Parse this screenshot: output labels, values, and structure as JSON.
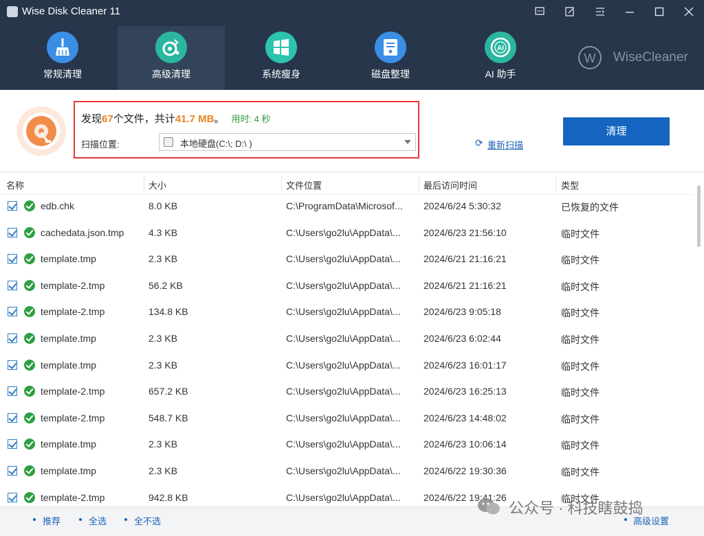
{
  "window": {
    "title": "Wise Disk Cleaner 11",
    "controls": [
      "feedback-icon",
      "notes-icon",
      "menu-icon",
      "minimize-icon",
      "maximize-icon",
      "close-icon"
    ]
  },
  "nav": {
    "items": [
      {
        "label": "常规清理",
        "icon": "broom-icon",
        "color": "#3a8ee6",
        "active": false
      },
      {
        "label": "高级清理",
        "icon": "advanced-clean-icon",
        "color": "#2bb6a0",
        "active": true
      },
      {
        "label": "系统瘦身",
        "icon": "windows-icon",
        "color": "#2cc3b0",
        "active": false
      },
      {
        "label": "磁盘整理",
        "icon": "defrag-icon",
        "color": "#3a8ee6",
        "active": false
      },
      {
        "label": "AI 助手",
        "icon": "ai-icon",
        "color": "#2bb6a0",
        "active": false
      }
    ],
    "brand": "WiseCleaner"
  },
  "summary": {
    "found_prefix": "发现",
    "file_count": "67",
    "files_word": "个文件，共计",
    "total_size": "41.7 MB",
    "period": "。",
    "time_used": "用时: 4 秒",
    "scan_location_label": "扫描位置:",
    "scan_location_value": "本地硬盘(C:\\; D:\\ )",
    "rescan_label": "重新扫描",
    "clean_button": "清理"
  },
  "table": {
    "headers": [
      "名称",
      "大小",
      "文件位置",
      "最后访问时间",
      "类型"
    ],
    "rows": [
      {
        "name": "edb.chk",
        "size": "8.0 KB",
        "path": "C:\\ProgramData\\Microsof...",
        "time": "2024/6/24 5:30:32",
        "type": "已恢复的文件"
      },
      {
        "name": "cachedata.json.tmp",
        "size": "4.3 KB",
        "path": "C:\\Users\\go2lu\\AppData\\...",
        "time": "2024/6/23 21:56:10",
        "type": "临时文件"
      },
      {
        "name": "template.tmp",
        "size": "2.3 KB",
        "path": "C:\\Users\\go2lu\\AppData\\...",
        "time": "2024/6/21 21:16:21",
        "type": "临时文件"
      },
      {
        "name": "template-2.tmp",
        "size": "56.2 KB",
        "path": "C:\\Users\\go2lu\\AppData\\...",
        "time": "2024/6/21 21:16:21",
        "type": "临时文件"
      },
      {
        "name": "template-2.tmp",
        "size": "134.8 KB",
        "path": "C:\\Users\\go2lu\\AppData\\...",
        "time": "2024/6/23 9:05:18",
        "type": "临时文件"
      },
      {
        "name": "template.tmp",
        "size": "2.3 KB",
        "path": "C:\\Users\\go2lu\\AppData\\...",
        "time": "2024/6/23 6:02:44",
        "type": "临时文件"
      },
      {
        "name": "template.tmp",
        "size": "2.3 KB",
        "path": "C:\\Users\\go2lu\\AppData\\...",
        "time": "2024/6/23 16:01:17",
        "type": "临时文件"
      },
      {
        "name": "template-2.tmp",
        "size": "657.2 KB",
        "path": "C:\\Users\\go2lu\\AppData\\...",
        "time": "2024/6/23 16:25:13",
        "type": "临时文件"
      },
      {
        "name": "template-2.tmp",
        "size": "548.7 KB",
        "path": "C:\\Users\\go2lu\\AppData\\...",
        "time": "2024/6/23 14:48:02",
        "type": "临时文件"
      },
      {
        "name": "template.tmp",
        "size": "2.3 KB",
        "path": "C:\\Users\\go2lu\\AppData\\...",
        "time": "2024/6/23 10:06:14",
        "type": "临时文件"
      },
      {
        "name": "template.tmp",
        "size": "2.3 KB",
        "path": "C:\\Users\\go2lu\\AppData\\...",
        "time": "2024/6/22 19:30:36",
        "type": "临时文件"
      },
      {
        "name": "template-2.tmp",
        "size": "942.8 KB",
        "path": "C:\\Users\\go2lu\\AppData\\...",
        "time": "2024/6/22 19:41:26",
        "type": "临时文件"
      }
    ]
  },
  "footer": {
    "recommend": "推荐",
    "select_all": "全选",
    "select_none": "全不选",
    "advanced_settings": "高级设置"
  },
  "watermark": "公众号 · 科技瞎鼓捣"
}
